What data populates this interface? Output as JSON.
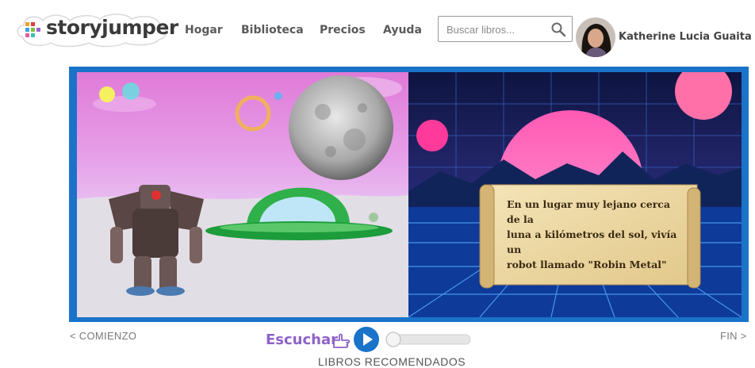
{
  "header": {
    "logo_text_1": "story",
    "logo_text_2": "jumper",
    "nav": [
      "Hogar",
      "Biblioteca",
      "Precios",
      "Ayuda"
    ],
    "search_placeholder": "Buscar libros...",
    "user_name": "Katherine Lucia Guaita A"
  },
  "book": {
    "page_text": [
      "En un lugar muy lejano cerca de la",
      "luna a kilómetros del sol, vivía un",
      "robot llamado \"Robin Metal\""
    ]
  },
  "controls": {
    "start": "< COMIENZO",
    "end": "FIN >",
    "listen": "Escuchar",
    "recommended": "LIBROS RECOMENDADOS"
  },
  "colors": {
    "frame": "#1a73c9",
    "listen": "#8e62c8",
    "play": "#1a73c9"
  }
}
